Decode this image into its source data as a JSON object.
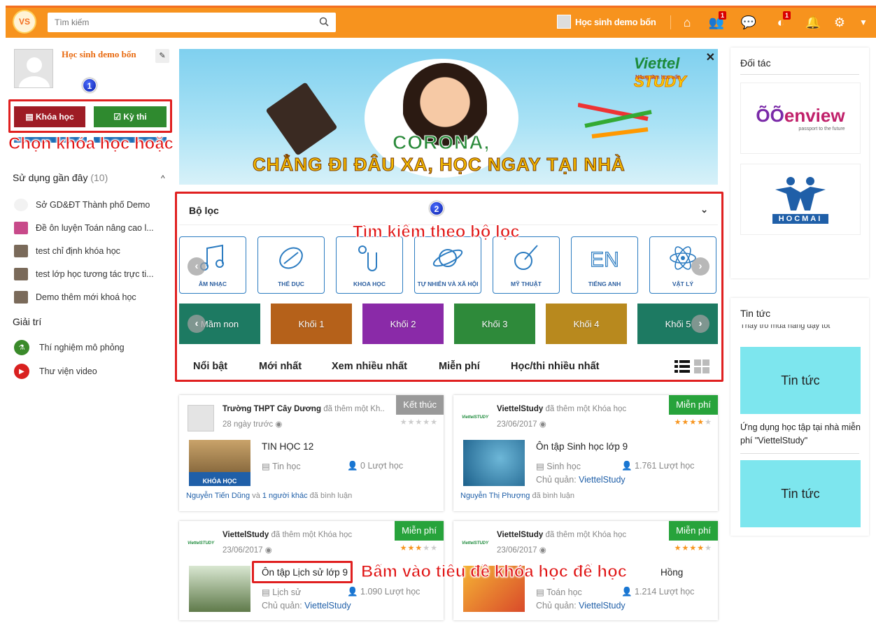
{
  "header": {
    "search_placeholder": "Tìm kiếm",
    "user_name": "Học sinh demo bốn",
    "badges": {
      "friends": "1",
      "messages": "1"
    }
  },
  "profile": {
    "name": "Học sinh demo bốn",
    "course_button": "Khóa học",
    "exam_button": "Kỳ thi"
  },
  "annotations": {
    "step1": "1",
    "step2": "2",
    "choose_text": "Chọn khóa học hoặc kỳ thi",
    "filter_text": "Tìm kiếm theo bộ lọc",
    "click_text": "Bấm vào tiêu đề khóa học để học"
  },
  "recent": {
    "title": "Sử dụng gần đây",
    "count": "(10)",
    "items": [
      {
        "label": "Sở GD&ĐT Thành phố Demo",
        "color": "#e8e8e8"
      },
      {
        "label": "Đề ôn luyện Toán nâng cao l...",
        "color": "#c84a8a"
      },
      {
        "label": "test chỉ định khóa học",
        "color": "#7a6a5a"
      },
      {
        "label": "test lớp học tương tác trực ti...",
        "color": "#7a6a5a"
      },
      {
        "label": "Demo thêm mới khoá học",
        "color": "#7a6a5a"
      }
    ]
  },
  "entertainment": {
    "title": "Giải trí",
    "items": [
      {
        "label": "Thí nghiệm mô phỏng",
        "color": "#3a8a2a"
      },
      {
        "label": "Thư viện video",
        "color": "#d9201f"
      }
    ]
  },
  "banner": {
    "brand_a": "Viettel",
    "brand_b": "STUDY",
    "slogan": "Nâng tầm học vấn",
    "line1": "CORONA,",
    "line2": "CHẲNG ĐI ĐÂU XA, HỌC NGAY TẠI NHÀ"
  },
  "filter": {
    "label": "Bộ lọc",
    "subjects": [
      "ÂM NHẠC",
      "THỂ DỤC",
      "KHOA HỌC",
      "TỰ NHIÊN VÀ XÃ HỘI",
      "MỸ THUẬT",
      "TIẾNG ANH",
      "VẬT LÝ"
    ],
    "grades": [
      {
        "label": "Mầm non",
        "color": "#1d7a62"
      },
      {
        "label": "Khối 1",
        "color": "#b5611a"
      },
      {
        "label": "Khối 2",
        "color": "#8a2aa8"
      },
      {
        "label": "Khối 3",
        "color": "#2e8a3a"
      },
      {
        "label": "Khối 4",
        "color": "#b8891e"
      },
      {
        "label": "Khối 5",
        "color": "#1d7a62"
      }
    ],
    "tabs": [
      "Nổi bật",
      "Mới nhất",
      "Xem nhiều nhất",
      "Miễn phí",
      "Học/thi nhiều nhất"
    ]
  },
  "cards": [
    {
      "author": "Trường THPT Cây Dương",
      "action": "đã thêm một Kh...",
      "time": "28 ngày trước",
      "ribbon": "Kết thúc",
      "rating": 0,
      "title": "TIN HỌC 12",
      "subject": "Tin học",
      "views": "0 Lượt học",
      "owner_label": "",
      "owner": "",
      "comment_user": "Nguyễn Tiến Dũng",
      "comment_rest": "và",
      "comment_more": "1 người khác",
      "comment_tail": "đã bình luận",
      "thumb_label": "KHÓA HỌC"
    },
    {
      "author": "ViettelStudy",
      "action": "đã thêm một Khóa học",
      "time": "23/06/2017",
      "ribbon": "Miễn phí",
      "rating": 4,
      "title": "Ôn tập Sinh học lớp 9",
      "subject": "Sinh học",
      "views": "1.761 Lượt học",
      "owner_label": "Chủ quản:",
      "owner": "ViettelStudy",
      "comment_user": "Nguyễn Thị Phượng",
      "comment_rest": "",
      "comment_more": "",
      "comment_tail": "đã bình luận"
    },
    {
      "author": "ViettelStudy",
      "action": "đã thêm một Khóa học",
      "time": "23/06/2017",
      "ribbon": "Miễn phí",
      "rating": 3,
      "title": "Ôn tập Lịch sử lớp 9",
      "subject": "Lịch sử",
      "views": "1.090 Lượt học",
      "owner_label": "Chủ quản:",
      "owner": "ViettelStudy"
    },
    {
      "author": "ViettelStudy",
      "action": "đã thêm một Khóa học",
      "time": "23/06/2017",
      "ribbon": "Miễn phí",
      "rating": 4,
      "title": "Hồng",
      "subject": "Toán học",
      "views": "1.214 Lượt học",
      "owner_label": "Chủ quản:",
      "owner": "ViettelStudy"
    }
  ],
  "partners": {
    "title": "Đối tác",
    "enview": "enview",
    "enview_tag": "passport to the future",
    "hocmai": "HOCMAI"
  },
  "news": {
    "title": "Tin tức",
    "cut_text": "Thầy trò mùa nắng dạy tốt",
    "img_label": "Tin tức",
    "headline": "Ứng dụng học tập tại nhà miễn phí \"ViettelStudy\""
  }
}
